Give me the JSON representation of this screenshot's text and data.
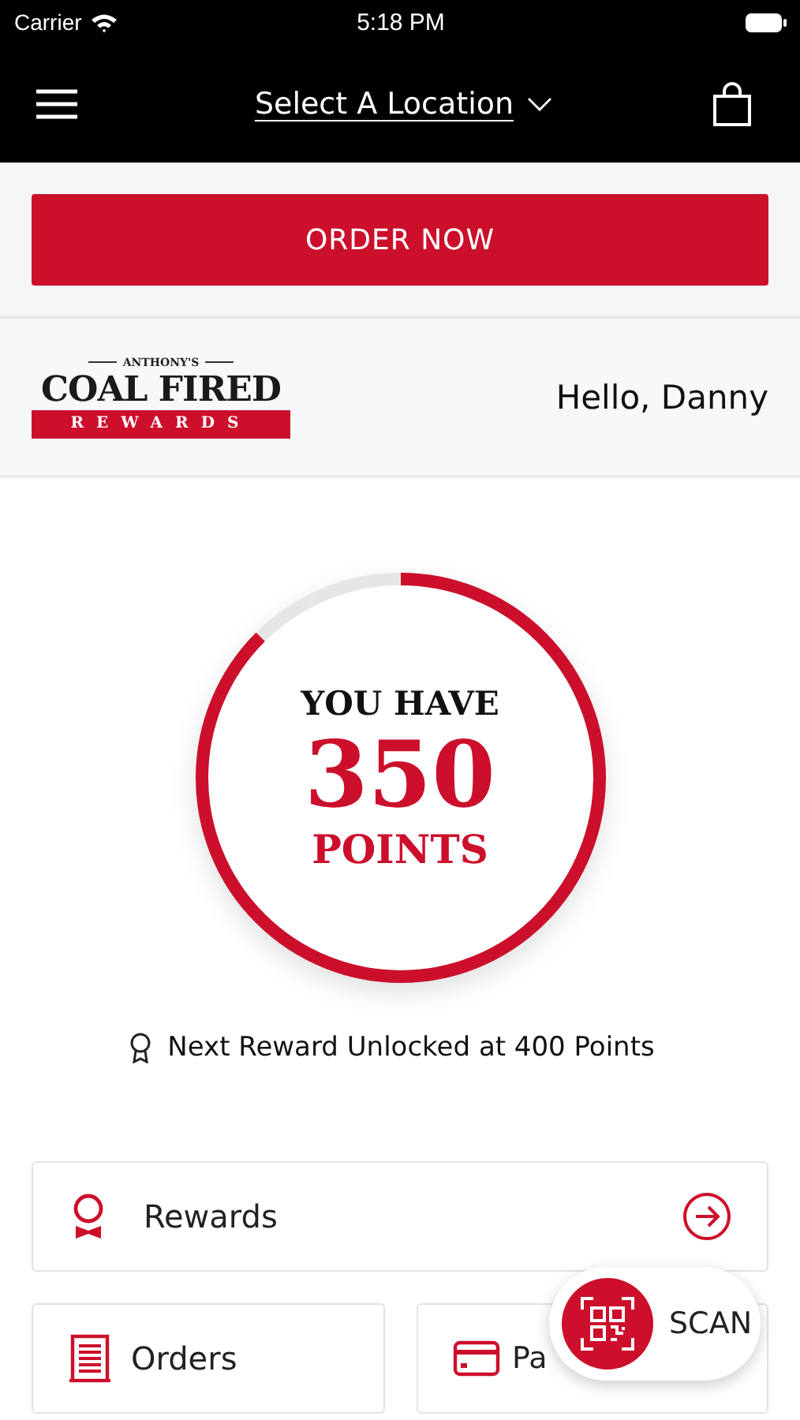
{
  "status_bar": {
    "carrier": "Carrier",
    "time": "5:18 PM"
  },
  "nav": {
    "location": "Select A Location"
  },
  "order_button": "ORDER NOW",
  "logo": {
    "top": "ANTHONY'S",
    "main": "COAL FIRED",
    "band": "REWARDS"
  },
  "greeting": "Hello, Danny",
  "points": {
    "heading": "YOU HAVE",
    "value": "350",
    "unit": "POINTS",
    "level": 0.875
  },
  "next_reward": "Next Reward Unlocked at 400 Points",
  "tiles": [
    {
      "kind": "rewards",
      "label": "Rewards"
    },
    {
      "kind": "orders",
      "label": "Orders"
    },
    {
      "kind": "pay",
      "label": "Pa"
    }
  ],
  "scan_button": "SCAN"
}
